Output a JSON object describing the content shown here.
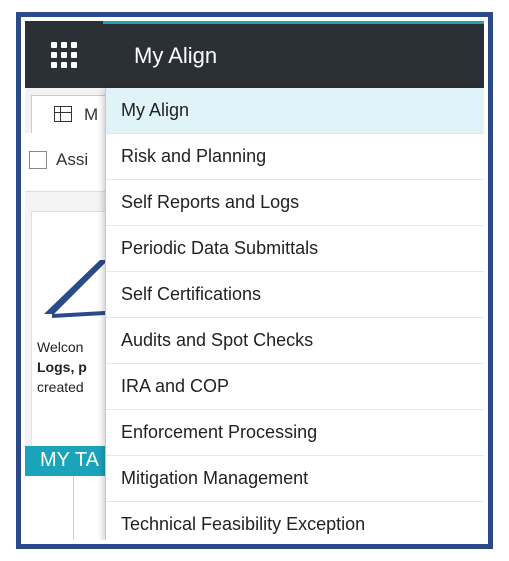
{
  "header": {
    "app_title": "My Align",
    "menu_icon": "app-launcher-grid-icon"
  },
  "background": {
    "tab_label": "M",
    "tab_icon": "table-grid-icon",
    "assign_label": "Assi",
    "welcome_lines": [
      "Welcon",
      "Logs, p",
      "created"
    ],
    "my_tasks_label": "MY TA"
  },
  "dropdown": {
    "items": [
      {
        "label": "My Align",
        "active": true
      },
      {
        "label": "Risk and Planning"
      },
      {
        "label": "Self Reports and Logs"
      },
      {
        "label": "Periodic Data Submittals"
      },
      {
        "label": "Self Certifications"
      },
      {
        "label": "Audits and Spot Checks"
      },
      {
        "label": "IRA and COP"
      },
      {
        "label": "Enforcement Processing"
      },
      {
        "label": "Mitigation Management"
      },
      {
        "label": "Technical Feasibility Exception"
      }
    ]
  },
  "colors": {
    "frame": "#2a4a8a",
    "topbar": "#2b2f36",
    "accent_teal": "#20a5a8",
    "tasks_bar": "#1ba3bb",
    "active_item_bg": "#dff3f9"
  }
}
